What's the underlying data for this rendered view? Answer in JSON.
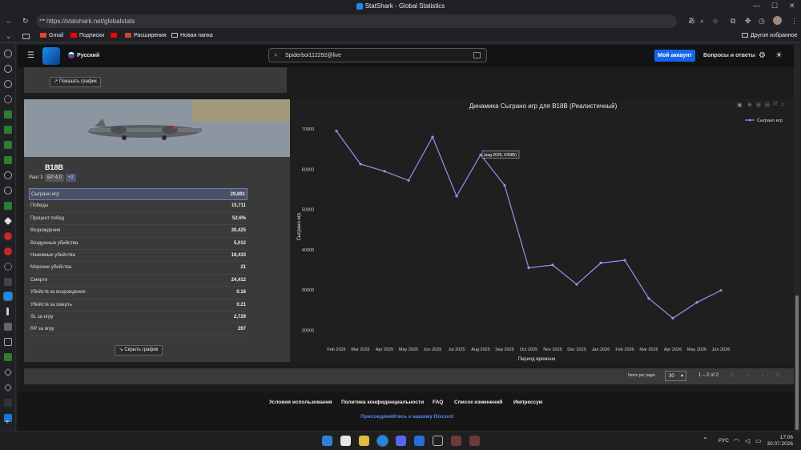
{
  "window": {
    "title": "StatShark - Global Statistics"
  },
  "browser": {
    "url": "https://statshark.net/globalstats",
    "bookmarks": [
      "Gmail",
      "Подписки",
      "Расширения",
      "Новая папка"
    ],
    "other_bookmarks": "Другое избранное"
  },
  "header": {
    "language": "Русский",
    "search_value": "Spiderboi112292@live",
    "account_button": "Мой аккаунт",
    "faq_link": "Вопросы и ответы"
  },
  "prev_card": {
    "show_chart_button": "Показать график"
  },
  "vehicle": {
    "name": "B18B",
    "rank": "Ранг 3",
    "br": "БР 4.0",
    "extra_badge": "+2",
    "stats": [
      {
        "label": "Сыграно игр",
        "value": "29,891"
      },
      {
        "label": "Победы",
        "value": "15,711"
      },
      {
        "label": "Процент побед",
        "value": "52.6%"
      },
      {
        "label": "Возрождения",
        "value": "30,425"
      },
      {
        "label": "Воздушные убийства",
        "value": "5,012"
      },
      {
        "label": "Наземные убийства",
        "value": "18,433"
      },
      {
        "label": "Морские убийства",
        "value": "21"
      },
      {
        "label": "Смерти",
        "value": "24,412"
      },
      {
        "label": "Убийств за возрождение",
        "value": "0.16"
      },
      {
        "label": "Убийств за смерть",
        "value": "0.21"
      },
      {
        "label": "SL за игру",
        "value": "2,729"
      },
      {
        "label": "RP за игру",
        "value": "267"
      }
    ],
    "hide_chart_button": "Скрыть график"
  },
  "chart_data": {
    "type": "line",
    "title": "Динамика Сыграно игр для B18B (Реалистичный)",
    "xlabel": "Период времени",
    "ylabel": "Сыграно игр",
    "categories": [
      "feb 2025",
      "mar 2025",
      "apr 2025",
      "may 2025",
      "jun 2025",
      "jul 2025",
      "aug 2025",
      "sep 2025",
      "oct 2025",
      "nov 2025",
      "dec 2025",
      "jan 2026",
      "feb 2026",
      "mar 2026",
      "apr 2026",
      "may 2026",
      "jun 2026"
    ],
    "series": [
      {
        "name": "Сыграно игр",
        "color": "#8f96ee",
        "values": [
          69500,
          61300,
          59500,
          57200,
          68000,
          53300,
          63585,
          56000,
          35500,
          36200,
          31400,
          36700,
          37400,
          27900,
          23000,
          26900,
          29900
        ]
      }
    ],
    "yticks": [
      20000,
      30000,
      40000,
      50000,
      60000,
      70000
    ],
    "ylim": [
      18500,
      73000
    ],
    "hover_label": "(aug 2025, 63585)",
    "legend": "top-right",
    "grid": false
  },
  "pager": {
    "items_per_page_label": "Items per page:",
    "items_per_page": "30",
    "range": "1 – 2 of 2"
  },
  "footer": {
    "links": [
      "Условия использования",
      "Политика конфиденциальности",
      "FAQ",
      "Список изменений",
      "Импрессум"
    ],
    "discord": "Присоединяйтесь к нашему Discord"
  },
  "taskbar": {
    "lang": "РУС",
    "time": "17:06",
    "date": "30.07.2026"
  }
}
